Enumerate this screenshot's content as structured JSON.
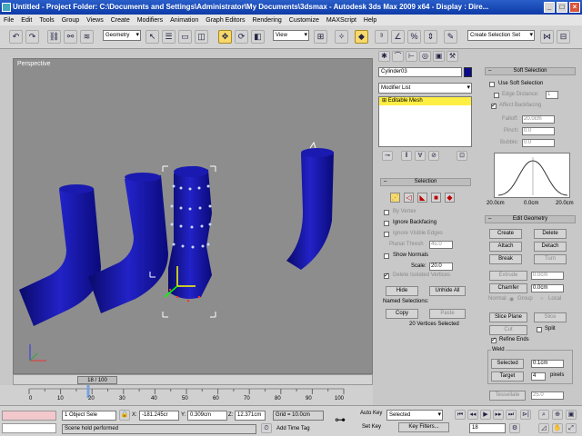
{
  "window": {
    "title": "Untitled    - Project Folder: C:\\Documents and Settings\\Administrator\\My Documents\\3dsmax    - Autodesk 3ds Max  2009 x64       - Display : Dire..."
  },
  "menu": [
    "File",
    "Edit",
    "Tools",
    "Group",
    "Views",
    "Create",
    "Modifiers",
    "Animation",
    "Graph Editors",
    "Rendering",
    "Customize",
    "MAXScript",
    "Help"
  ],
  "toolbar": {
    "selection_filter": "Geometry",
    "ref_coord": "View",
    "named_selection": "Create Selection Set"
  },
  "viewport": {
    "label": "Perspective"
  },
  "time_slider": {
    "label": "18 / 100"
  },
  "timeline_ticks": [
    "0",
    "10",
    "20",
    "30",
    "40",
    "50",
    "60",
    "70",
    "80",
    "90",
    "100"
  ],
  "command_panel": {
    "object_name": "Cylinder03",
    "object_color": "#0a0a8c",
    "modifier_list": "Modifier List",
    "stack_item": "Editable Mesh",
    "selection": {
      "title": "Selection",
      "by_vertex": "By Vertex",
      "ignore_backfacing": "Ignore Backfacing",
      "ignore_visible_edges": "Ignore Visible Edges",
      "planar_thresh_label": "Planar Thresh",
      "planar_thresh_value": "45.0",
      "show_normals": "Show Normals",
      "scale_label": "Scale:",
      "scale_value": "20.0",
      "delete_isolated": "Delete Isolated Vertices",
      "hide": "Hide",
      "unhide_all": "Unhide All",
      "named_selections": "Named Selections:",
      "copy": "Copy",
      "paste": "Paste",
      "status": "20 Vertices Selected"
    }
  },
  "soft_selection": {
    "title": "Soft Selection",
    "use_soft": "Use Soft Selection",
    "edge_distance": "Edge Distance:",
    "edge_distance_value": "1",
    "affect_backfacing": "Affect Backfacing",
    "falloff_label": "Falloff:",
    "falloff_value": "20.0cm",
    "pinch_label": "Pinch:",
    "pinch_value": "0.0",
    "bubble_label": "Bubble:",
    "bubble_value": "0.0",
    "curve_left": "20.0cm",
    "curve_mid": "0.0cm",
    "curve_right": "20.0cm"
  },
  "edit_geometry": {
    "title": "Edit Geometry",
    "create": "Create",
    "delete": "Delete",
    "attach": "Attach",
    "detach": "Detach",
    "break": "Break",
    "turn": "Turn",
    "extrude": "Extrude",
    "extrude_value": "0.0cm",
    "chamfer": "Chamfer",
    "chamfer_value": "0.0cm",
    "normal_label": "Normal:",
    "group": "Group",
    "local": "Local",
    "slice_plane": "Slice Plane",
    "slice": "Slice",
    "cut": "Cut",
    "split": "Split",
    "refine_ends": "Refine Ends",
    "weld": "Weld",
    "selected": "Selected",
    "selected_value": "0.1cm",
    "target": "Target",
    "target_value": "4",
    "pixels": "pixels",
    "tessellate": "Tessellate",
    "tessellate_value": "25.0"
  },
  "status": {
    "objects_selected": "1 Object Sele",
    "x": "-181.245cr",
    "y": "0.309cm",
    "z": "12.371cm",
    "grid": "Grid = 10.0cm",
    "prompt": "Scene hold performed",
    "add_time_tag": "Add Time Tag",
    "auto_key": "Auto Key",
    "set_key": "Set Key",
    "key_mode": "Selected",
    "key_filters": "Key Filters...",
    "frame": "18"
  }
}
